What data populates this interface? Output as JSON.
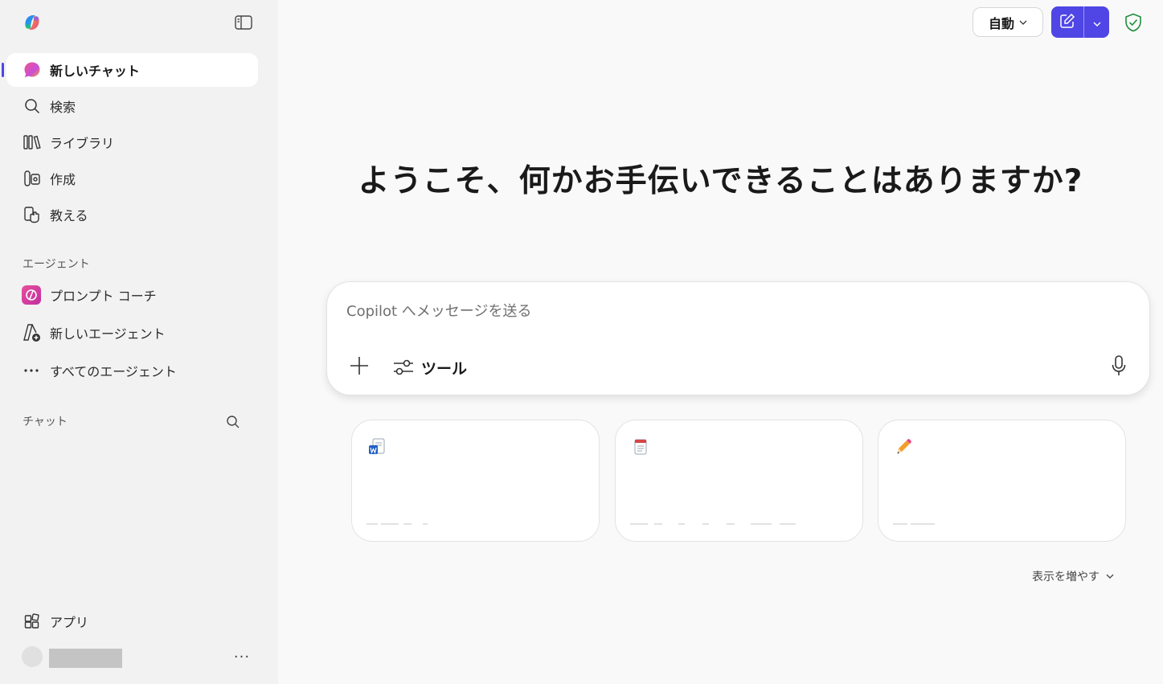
{
  "sidebar": {
    "nav": [
      {
        "label": "新しいチャット",
        "icon": "copilot-chat-icon",
        "active": true
      },
      {
        "label": "検索",
        "icon": "search-icon"
      },
      {
        "label": "ライブラリ",
        "icon": "library-icon"
      },
      {
        "label": "作成",
        "icon": "create-icon"
      },
      {
        "label": "教える",
        "icon": "teach-icon"
      }
    ],
    "agents_label": "エージェント",
    "agents": [
      {
        "label": "プロンプト コーチ",
        "icon": "prompt-coach-icon"
      },
      {
        "label": "新しいエージェント",
        "icon": "new-agent-icon"
      },
      {
        "label": "すべてのエージェント",
        "icon": "more-dots-icon"
      }
    ],
    "chats_label": "チャット",
    "apps_label": "アプリ",
    "more_label": "···"
  },
  "header": {
    "mode_label": "自動"
  },
  "main": {
    "headline": "ようこそ、何かお手伝いできることはありますか?",
    "composer": {
      "placeholder": "Copilot へメッセージを送る",
      "tools_label": "ツール"
    },
    "cards": [
      {
        "icon": "word-doc-icon"
      },
      {
        "icon": "notepad-icon"
      },
      {
        "icon": "pencil-icon"
      }
    ],
    "show_more_label": "表示を増やす"
  },
  "colors": {
    "accent": "#4f46e5",
    "shield": "#1e8f3e",
    "sidebar_bg": "#f2f2f2",
    "main_bg": "#f9f9f9"
  }
}
